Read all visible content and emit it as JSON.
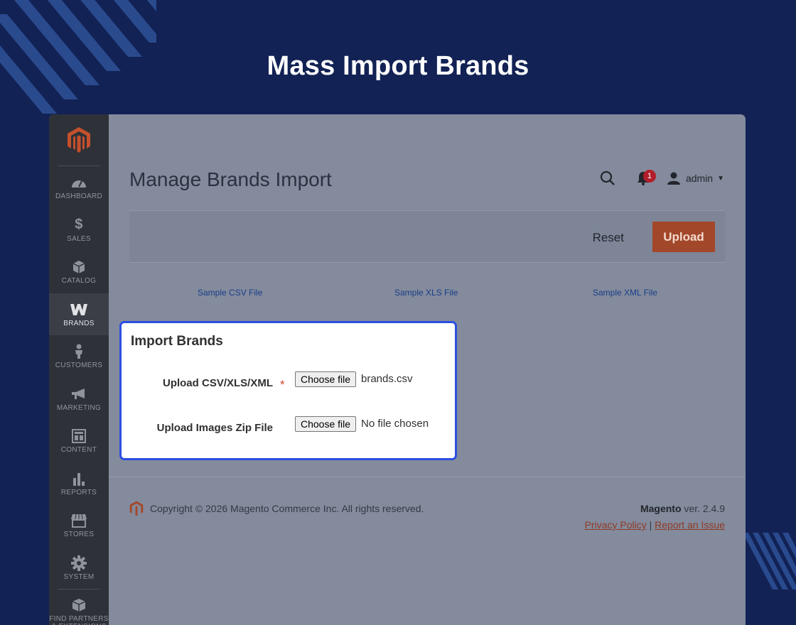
{
  "banner": {
    "title": "Mass Import Brands"
  },
  "sidebar": {
    "items": [
      {
        "label": "DASHBOARD",
        "icon": "dashboard-icon"
      },
      {
        "label": "SALES",
        "icon": "dollar-icon"
      },
      {
        "label": "CATALOG",
        "icon": "catalog-box-icon"
      },
      {
        "label": "BRANDS",
        "icon": "brands-w-icon",
        "active": true
      },
      {
        "label": "CUSTOMERS",
        "icon": "customer-person-icon"
      },
      {
        "label": "MARKETING",
        "icon": "megaphone-icon"
      },
      {
        "label": "CONTENT",
        "icon": "content-layout-icon"
      },
      {
        "label": "REPORTS",
        "icon": "bar-chart-icon"
      },
      {
        "label": "STORES",
        "icon": "store-icon"
      },
      {
        "label": "SYSTEM",
        "icon": "gear-icon"
      },
      {
        "label": "FIND PARTNERS & EXTENSIONS",
        "icon": "partners-box-icon"
      }
    ]
  },
  "header": {
    "page_title": "Manage Brands Import",
    "notification_count": "1",
    "user_name": "admin"
  },
  "actions": {
    "reset_label": "Reset",
    "upload_label": "Upload"
  },
  "samples": {
    "csv": "Sample CSV File",
    "xls": "Sample XLS File",
    "xml": "Sample XML File"
  },
  "import_form": {
    "title": "Import Brands",
    "file_label": "Upload CSV/XLS/XML",
    "required_mark": "*",
    "file_button": "Choose file",
    "file_value": "brands.csv",
    "zip_label": "Upload Images Zip File",
    "zip_button": "Choose file",
    "zip_value": "No file chosen"
  },
  "footer": {
    "copyright": "Copyright © 2026 Magento Commerce Inc. All rights reserved.",
    "brand": "Magento",
    "version": " ver. 2.4.9",
    "privacy_link": "Privacy Policy",
    "separator": "|",
    "report_link": "Report an Issue"
  },
  "colors": {
    "page_bg": "#122254",
    "accent_orange": "#a3472a",
    "highlight_border": "#2c4fe0",
    "sidebar_bg": "#2e3138"
  }
}
